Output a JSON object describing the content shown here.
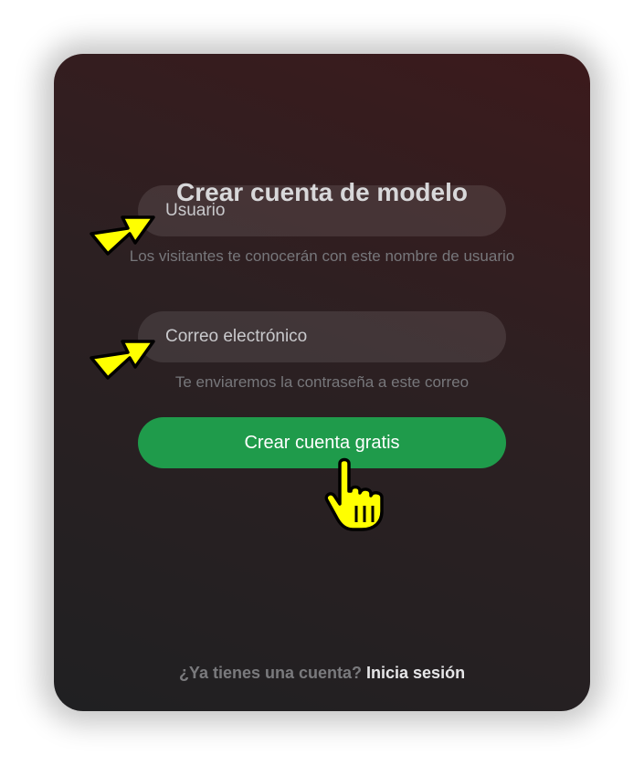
{
  "form": {
    "title": "Crear cuenta de modelo",
    "username": {
      "placeholder": "Usuario",
      "hint": "Los visitantes te conocerán con este nombre de usuario"
    },
    "email": {
      "placeholder": "Correo electrónico",
      "hint": "Te enviaremos la contraseña a este correo"
    },
    "submit_label": "Crear cuenta gratis"
  },
  "footer": {
    "question": "¿Ya tienes una cuenta?",
    "login_link": "Inicia sesión"
  },
  "colors": {
    "accent": "#1f9b4b",
    "annotation": "#ffff00"
  },
  "annotations": {
    "arrow_icon": "arrow-right-icon",
    "cursor_icon": "hand-pointer-icon"
  }
}
